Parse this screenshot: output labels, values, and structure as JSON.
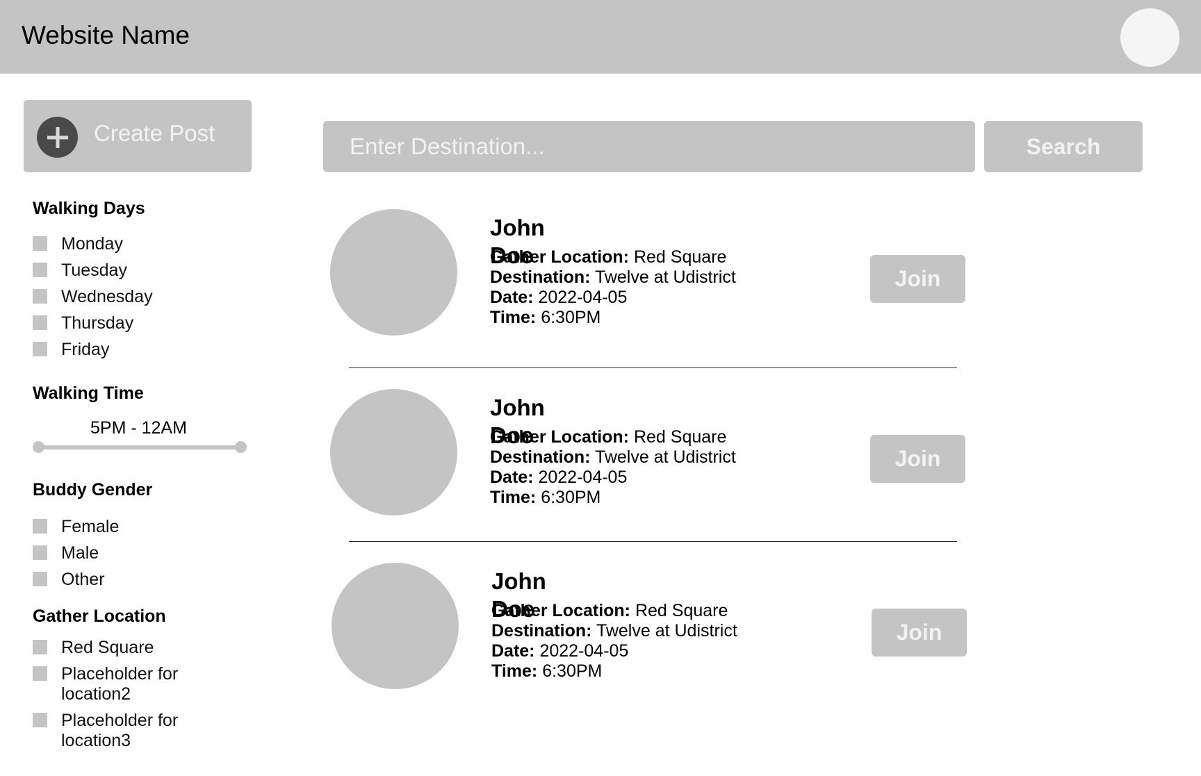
{
  "header": {
    "site_name": "Website Name"
  },
  "sidebar": {
    "create_post_label": "Create Post",
    "walking_days": {
      "title": "Walking Days",
      "options": [
        "Monday",
        "Tuesday",
        "Wednesday",
        "Thursday",
        "Friday"
      ]
    },
    "walking_time": {
      "title": "Walking Time",
      "range_label": "5PM - 12AM"
    },
    "buddy_gender": {
      "title": "Buddy Gender",
      "options": [
        "Female",
        "Male",
        "Other"
      ]
    },
    "gather_location": {
      "title": "Gather Location",
      "options": [
        "Red Square",
        "Placeholder for location2",
        "Placeholder for location3"
      ]
    }
  },
  "search": {
    "placeholder": "Enter Destination...",
    "button_label": "Search"
  },
  "posts": [
    {
      "name": "John Doe",
      "gather_label": "Gather Location:",
      "gather_value": "Red Square",
      "destination_label": "Destination:",
      "destination_value": "Twelve at Udistrict",
      "date_label": "Date:",
      "date_value": "2022-04-05",
      "time_label": "Time:",
      "time_value": "6:30PM",
      "join_label": "Join"
    },
    {
      "name": "John Doe",
      "gather_label": "Gather Location:",
      "gather_value": "Red Square",
      "destination_label": "Destination:",
      "destination_value": "Twelve at Udistrict",
      "date_label": "Date:",
      "date_value": "2022-04-05",
      "time_label": "Time:",
      "time_value": "6:30PM",
      "join_label": "Join"
    },
    {
      "name": "John Doe",
      "gather_label": "Gather Location:",
      "gather_value": "Red Square",
      "destination_label": "Destination:",
      "destination_value": "Twelve at Udistrict",
      "date_label": "Date:",
      "date_value": "2022-04-05",
      "time_label": "Time:",
      "time_value": "6:30PM",
      "join_label": "Join"
    }
  ],
  "colors": {
    "header_bg": "#c4c4c4",
    "control_gray": "#c4c4c4",
    "plus_circle": "#4a4a4a"
  }
}
